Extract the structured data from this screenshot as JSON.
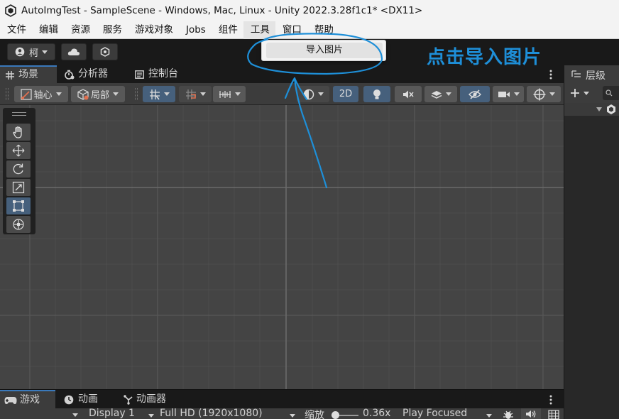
{
  "window": {
    "title": "AutoImgTest - SampleScene - Windows, Mac, Linux - Unity 2022.3.28f1c1* <DX11>"
  },
  "menu": [
    "文件",
    "编辑",
    "资源",
    "服务",
    "游戏对象",
    "Jobs",
    "组件",
    "工具",
    "窗口",
    "帮助"
  ],
  "dropdown": {
    "item": "导入图片"
  },
  "annotation": {
    "text": "点击导入图片",
    "color": "#1e8fd8"
  },
  "toolbar": {
    "account_label": "柯"
  },
  "scene_tabs": [
    "场景",
    "分析器",
    "控制台"
  ],
  "scene_toolbar": {
    "pivot_label": "轴心",
    "local_label": "局部",
    "mode_2d": "2D"
  },
  "hierarchy": {
    "title": "层级"
  },
  "bottom_tabs": [
    "游戏",
    "动画",
    "动画器"
  ],
  "game_toolbar": {
    "display": "Display 1",
    "resolution": "Full HD (1920x1080)",
    "scale_label": "缩放",
    "scale_value": "0.36x",
    "play_mode": "Play Focused"
  },
  "colors": {
    "accent_blue": "#46607c",
    "tab_highlight": "#3a79bb"
  }
}
